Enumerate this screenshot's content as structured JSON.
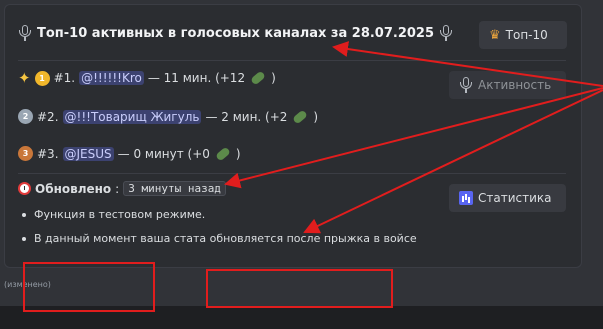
{
  "embed": {
    "title": "Топ-10 активных в голосовых каналах за 28.07.2025",
    "entries": [
      {
        "rank": "#1.",
        "medal": "1",
        "user": "@!!!!!!Kro",
        "stat": " — 11 мин. (+12 ",
        "close": ")"
      },
      {
        "rank": "#2.",
        "medal": "2",
        "user": "@!!!Товарищ Жигуль",
        "stat": " — 2 мин. (+2 ",
        "close": ")"
      },
      {
        "rank": "#3.",
        "medal": "3",
        "user": "@JESUS",
        "stat": " — 0 минут (+0 ",
        "close": ")"
      }
    ],
    "updated_label": "Обновлено",
    "updated_colon": ":",
    "updated_value": "3 минуты назад",
    "bullets": [
      "Функция в тестовом режиме.",
      "В данный момент ваша стата обновляется после прыжка в войсе"
    ]
  },
  "buttons": {
    "top10": "Топ-10",
    "activity": "Активность",
    "stats": "Статистика"
  },
  "edited_note": "(изменено)",
  "icons": [
    "microphone-icon",
    "sparkles-icon",
    "medal-icon",
    "bottle-icon",
    "alarm-clock-icon",
    "crown-icon",
    "bar-chart-icon"
  ],
  "colors": {
    "annotation": "#e11d1d",
    "mention_bg": "#3c4270",
    "button_bg": "#383a40"
  }
}
